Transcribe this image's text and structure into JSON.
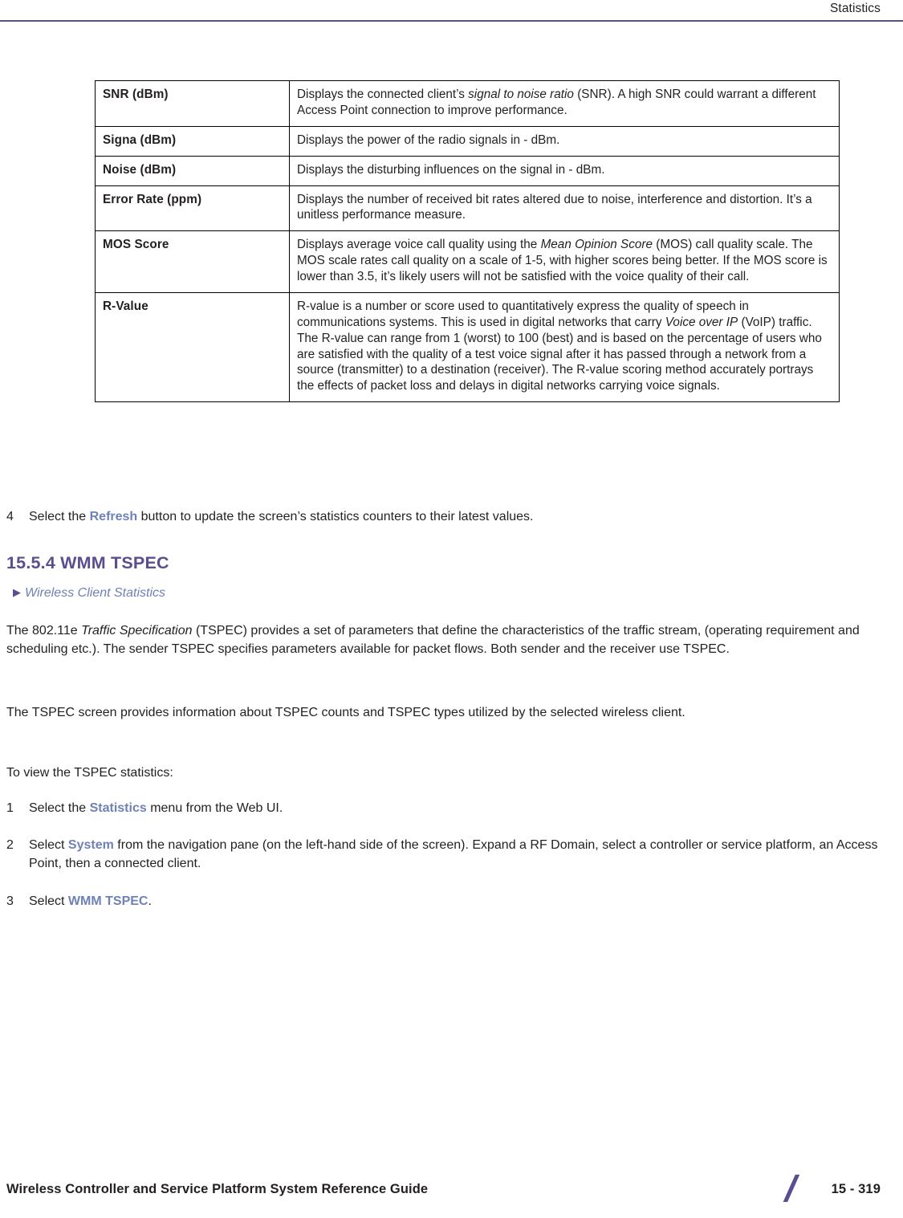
{
  "header": {
    "title": "Statistics"
  },
  "table": {
    "rows": [
      {
        "name": "SNR (dBm)",
        "desc_parts": [
          {
            "text": "Displays the connected client’s ",
            "style": "normal"
          },
          {
            "text": "signal to noise ratio",
            "style": "italic"
          },
          {
            "text": " (SNR). A high SNR could warrant a different Access Point connection to improve performance.",
            "style": "normal"
          }
        ]
      },
      {
        "name": "Signa (dBm)",
        "desc_parts": [
          {
            "text": "Displays the power of the radio signals in - dBm.",
            "style": "normal"
          }
        ]
      },
      {
        "name": "Noise (dBm)",
        "desc_parts": [
          {
            "text": "Displays the disturbing influences on the signal in - dBm.",
            "style": "normal"
          }
        ]
      },
      {
        "name": "Error Rate (ppm)",
        "desc_parts": [
          {
            "text": "Displays the number of received bit rates altered due to noise, interference and distortion. It’s a unitless performance measure.",
            "style": "normal"
          }
        ]
      },
      {
        "name": "MOS Score",
        "desc_parts": [
          {
            "text": "Displays average voice call quality using the ",
            "style": "normal"
          },
          {
            "text": "Mean Opinion Score",
            "style": "italic"
          },
          {
            "text": " (MOS) call quality scale. The MOS scale rates call quality on a scale of 1-5, with higher scores being better. If the MOS score is lower than 3.5, it’s likely users will not be satisfied with the voice quality of their call.",
            "style": "normal"
          }
        ]
      },
      {
        "name": "R-Value",
        "desc_parts": [
          {
            "text": "R-value is a number or score used to quantitatively express the quality of speech in communications systems. This is used in digital networks that carry ",
            "style": "normal"
          },
          {
            "text": "Voice over IP",
            "style": "italic"
          },
          {
            "text": " (VoIP) traffic. The R-value can range from 1 (worst) to 100 (best) and is based on the percentage of users who are satisfied with the quality of a test voice signal after it has passed through a network from a source (transmitter) to a destination (receiver). The R-value scoring method accurately portrays the effects of packet loss and delays in digital networks carrying voice signals.",
            "style": "normal"
          }
        ]
      }
    ]
  },
  "content": {
    "step4": {
      "num": "4",
      "pre": "Select the ",
      "link": "Refresh",
      "post": " button to update the screen’s statistics counters to their latest values."
    },
    "section_heading": "15.5.4 WMM TSPEC",
    "cross_reference": "Wireless Client Statistics",
    "paragraph1_parts": [
      {
        "text": "The 802.11e ",
        "style": "normal"
      },
      {
        "text": "Traffic Specification",
        "style": "italic"
      },
      {
        "text": " (TSPEC) provides a set of parameters that define the characteristics of the traffic stream, (operating requirement and scheduling etc.). The sender TSPEC specifies parameters available for packet flows. Both sender and the receiver use TSPEC.",
        "style": "normal"
      }
    ],
    "paragraph2": "The TSPEC screen provides information about TSPEC counts and TSPEC types utilized by the selected wireless client.",
    "paragraph3": "To view the TSPEC statistics:",
    "step1": {
      "num": "1",
      "pre": "Select the ",
      "link": "Statistics",
      "post": " menu from the Web UI."
    },
    "step2": {
      "num": "2",
      "pre": "Select ",
      "link": "System",
      "post": " from the navigation pane (on the left-hand side of the screen). Expand a RF Domain, select a controller or service platform, an Access Point, then a connected client."
    },
    "step3": {
      "num": "3",
      "pre": "Select ",
      "link": "WMM TSPEC",
      "post": "."
    }
  },
  "footer": {
    "guide_title": "Wireless Controller and Service Platform System Reference Guide",
    "page_number": "15 - 319"
  }
}
